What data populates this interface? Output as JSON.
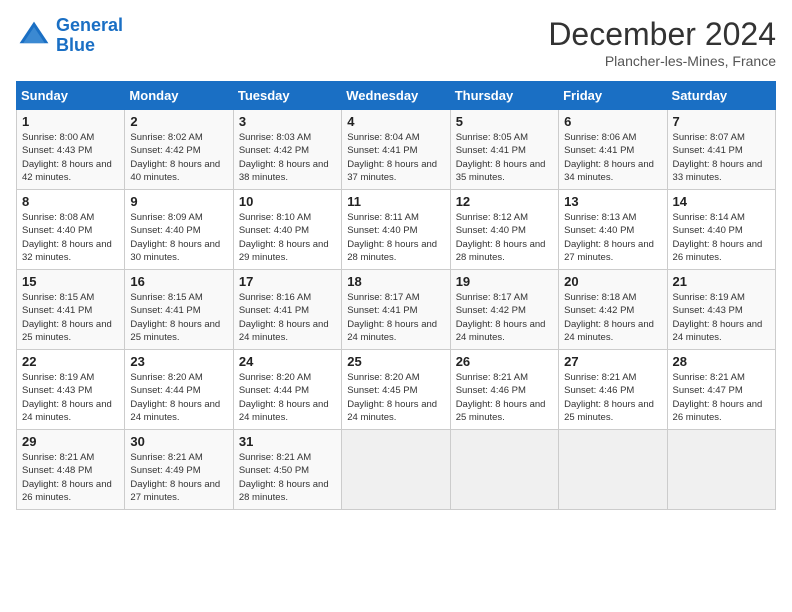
{
  "header": {
    "logo_line1": "General",
    "logo_line2": "Blue",
    "month": "December 2024",
    "location": "Plancher-les-Mines, France"
  },
  "days_of_week": [
    "Sunday",
    "Monday",
    "Tuesday",
    "Wednesday",
    "Thursday",
    "Friday",
    "Saturday"
  ],
  "weeks": [
    [
      {
        "day": "1",
        "sr": "8:00 AM",
        "ss": "4:43 PM",
        "dl": "8 hours and 42 minutes."
      },
      {
        "day": "2",
        "sr": "8:02 AM",
        "ss": "4:42 PM",
        "dl": "8 hours and 40 minutes."
      },
      {
        "day": "3",
        "sr": "8:03 AM",
        "ss": "4:42 PM",
        "dl": "8 hours and 38 minutes."
      },
      {
        "day": "4",
        "sr": "8:04 AM",
        "ss": "4:41 PM",
        "dl": "8 hours and 37 minutes."
      },
      {
        "day": "5",
        "sr": "8:05 AM",
        "ss": "4:41 PM",
        "dl": "8 hours and 35 minutes."
      },
      {
        "day": "6",
        "sr": "8:06 AM",
        "ss": "4:41 PM",
        "dl": "8 hours and 34 minutes."
      },
      {
        "day": "7",
        "sr": "8:07 AM",
        "ss": "4:41 PM",
        "dl": "8 hours and 33 minutes."
      }
    ],
    [
      {
        "day": "8",
        "sr": "8:08 AM",
        "ss": "4:40 PM",
        "dl": "8 hours and 32 minutes."
      },
      {
        "day": "9",
        "sr": "8:09 AM",
        "ss": "4:40 PM",
        "dl": "8 hours and 30 minutes."
      },
      {
        "day": "10",
        "sr": "8:10 AM",
        "ss": "4:40 PM",
        "dl": "8 hours and 29 minutes."
      },
      {
        "day": "11",
        "sr": "8:11 AM",
        "ss": "4:40 PM",
        "dl": "8 hours and 28 minutes."
      },
      {
        "day": "12",
        "sr": "8:12 AM",
        "ss": "4:40 PM",
        "dl": "8 hours and 28 minutes."
      },
      {
        "day": "13",
        "sr": "8:13 AM",
        "ss": "4:40 PM",
        "dl": "8 hours and 27 minutes."
      },
      {
        "day": "14",
        "sr": "8:14 AM",
        "ss": "4:40 PM",
        "dl": "8 hours and 26 minutes."
      }
    ],
    [
      {
        "day": "15",
        "sr": "8:15 AM",
        "ss": "4:41 PM",
        "dl": "8 hours and 25 minutes."
      },
      {
        "day": "16",
        "sr": "8:15 AM",
        "ss": "4:41 PM",
        "dl": "8 hours and 25 minutes."
      },
      {
        "day": "17",
        "sr": "8:16 AM",
        "ss": "4:41 PM",
        "dl": "8 hours and 24 minutes."
      },
      {
        "day": "18",
        "sr": "8:17 AM",
        "ss": "4:41 PM",
        "dl": "8 hours and 24 minutes."
      },
      {
        "day": "19",
        "sr": "8:17 AM",
        "ss": "4:42 PM",
        "dl": "8 hours and 24 minutes."
      },
      {
        "day": "20",
        "sr": "8:18 AM",
        "ss": "4:42 PM",
        "dl": "8 hours and 24 minutes."
      },
      {
        "day": "21",
        "sr": "8:19 AM",
        "ss": "4:43 PM",
        "dl": "8 hours and 24 minutes."
      }
    ],
    [
      {
        "day": "22",
        "sr": "8:19 AM",
        "ss": "4:43 PM",
        "dl": "8 hours and 24 minutes."
      },
      {
        "day": "23",
        "sr": "8:20 AM",
        "ss": "4:44 PM",
        "dl": "8 hours and 24 minutes."
      },
      {
        "day": "24",
        "sr": "8:20 AM",
        "ss": "4:44 PM",
        "dl": "8 hours and 24 minutes."
      },
      {
        "day": "25",
        "sr": "8:20 AM",
        "ss": "4:45 PM",
        "dl": "8 hours and 24 minutes."
      },
      {
        "day": "26",
        "sr": "8:21 AM",
        "ss": "4:46 PM",
        "dl": "8 hours and 25 minutes."
      },
      {
        "day": "27",
        "sr": "8:21 AM",
        "ss": "4:46 PM",
        "dl": "8 hours and 25 minutes."
      },
      {
        "day": "28",
        "sr": "8:21 AM",
        "ss": "4:47 PM",
        "dl": "8 hours and 26 minutes."
      }
    ],
    [
      {
        "day": "29",
        "sr": "8:21 AM",
        "ss": "4:48 PM",
        "dl": "8 hours and 26 minutes."
      },
      {
        "day": "30",
        "sr": "8:21 AM",
        "ss": "4:49 PM",
        "dl": "8 hours and 27 minutes."
      },
      {
        "day": "31",
        "sr": "8:21 AM",
        "ss": "4:50 PM",
        "dl": "8 hours and 28 minutes."
      },
      null,
      null,
      null,
      null
    ]
  ],
  "labels": {
    "sunrise": "Sunrise:",
    "sunset": "Sunset:",
    "daylight": "Daylight:"
  }
}
